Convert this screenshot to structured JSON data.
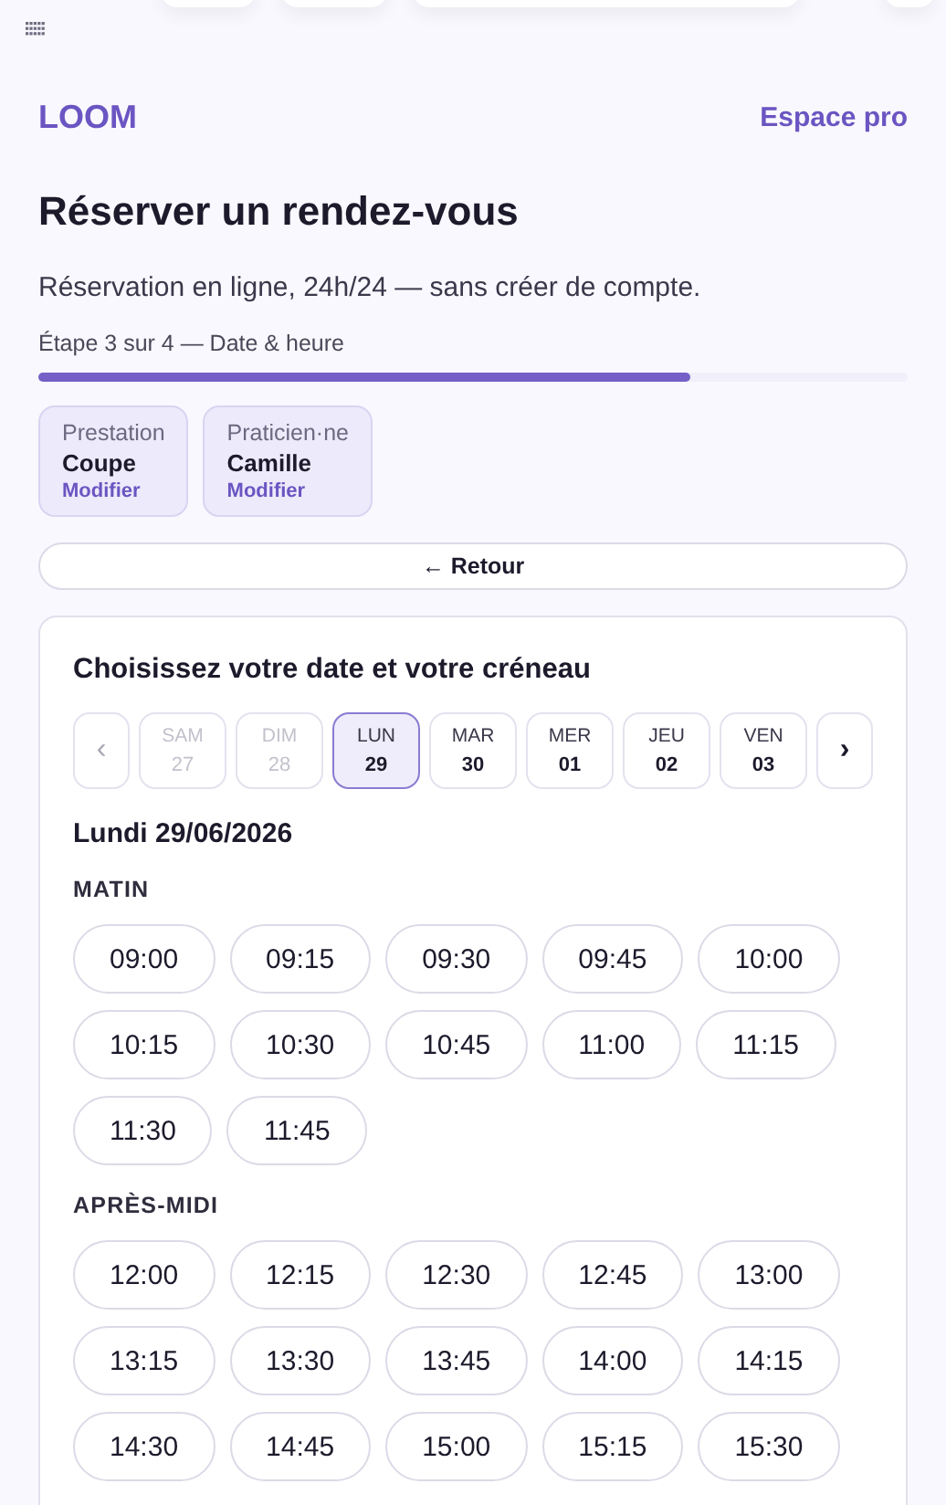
{
  "brand": "LOOM",
  "pro_link": "Espace pro",
  "title": "Réserver un rendez-vous",
  "subtitle": "Réservation en ligne, 24h/24 — sans créer de compte.",
  "step": {
    "label": "Étape 3 sur 4 — Date & heure",
    "level": 0.75
  },
  "summary": [
    {
      "label": "Prestation",
      "value": "Coupe",
      "action": "Modifier"
    },
    {
      "label": "Praticien·ne",
      "value": "Camille",
      "action": "Modifier"
    }
  ],
  "back_button": "← Retour",
  "card": {
    "title": "Choisissez votre date et votre créneau",
    "prev": {
      "label": "‹",
      "disabled": true
    },
    "next": {
      "label": "›",
      "disabled": false
    },
    "days": [
      {
        "day": "SAM",
        "date": "27",
        "disabled": true,
        "selected": false
      },
      {
        "day": "DIM",
        "date": "28",
        "disabled": true,
        "selected": false
      },
      {
        "day": "LUN",
        "date": "29",
        "disabled": false,
        "selected": true
      },
      {
        "day": "MAR",
        "date": "30",
        "disabled": false,
        "selected": false
      },
      {
        "day": "MER",
        "date": "01",
        "disabled": false,
        "selected": false
      },
      {
        "day": "JEU",
        "date": "02",
        "disabled": false,
        "selected": false
      },
      {
        "day": "VEN",
        "date": "03",
        "disabled": false,
        "selected": false
      }
    ],
    "date_label": "Lundi 29/06/2026",
    "sections": [
      {
        "heading": "MATIN",
        "slots": [
          "09:00",
          "09:15",
          "09:30",
          "09:45",
          "10:00",
          "10:15",
          "10:30",
          "10:45",
          "11:00",
          "11:15",
          "11:30",
          "11:45"
        ]
      },
      {
        "heading": "APRÈS-MIDI",
        "slots": [
          "12:00",
          "12:15",
          "12:30",
          "12:45",
          "13:00",
          "13:15",
          "13:30",
          "13:45",
          "14:00",
          "14:15",
          "14:30",
          "14:45",
          "15:00",
          "15:15",
          "15:30"
        ]
      }
    ]
  }
}
